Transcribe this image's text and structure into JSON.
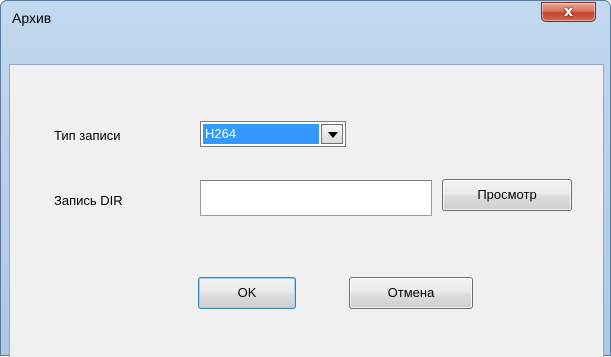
{
  "window": {
    "title": "Архив",
    "close_glyph": "x",
    "close_icon": "close-icon"
  },
  "form": {
    "record_type_label": "Тип записи",
    "record_type_value": "H264",
    "record_dir_label": "Запись DIR",
    "record_dir_value": "",
    "browse_label": "Просмотр"
  },
  "actions": {
    "ok_label": "OK",
    "cancel_label": "Отмена"
  },
  "colors": {
    "title_bar": "#b9d1ea",
    "close_button": "#c2462e",
    "selection": "#3399ff",
    "client_area": "#f0f0f0"
  }
}
